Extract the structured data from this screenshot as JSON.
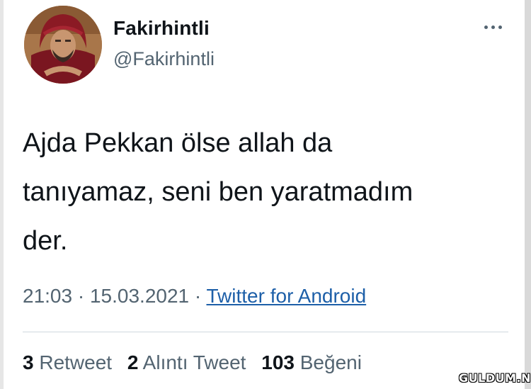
{
  "author": {
    "name": "Fakirhintli",
    "handle": "@Fakirhintli",
    "avatar_icon": "person-with-red-turban-avatar"
  },
  "menu": {
    "more_icon": "ellipsis-icon"
  },
  "tweet": {
    "text": "Ajda Pekkan ölse allah da\ntanıyamaz, seni ben yaratmadım\nder."
  },
  "meta": {
    "time": "21:03",
    "date": "15.03.2021",
    "separator": "·",
    "source": "Twitter for Android"
  },
  "stats": {
    "retweets": {
      "count": "3",
      "label": "Retweet"
    },
    "quotes": {
      "count": "2",
      "label": "Alıntı Tweet"
    },
    "likes": {
      "count": "103",
      "label": "Beğeni"
    }
  },
  "watermark": "GULDUM.NET",
  "colors": {
    "text": "#0f1419",
    "secondary": "#536471",
    "link": "#1d5fa8",
    "divider": "#cfd9de",
    "turban": "#8b1a24"
  }
}
